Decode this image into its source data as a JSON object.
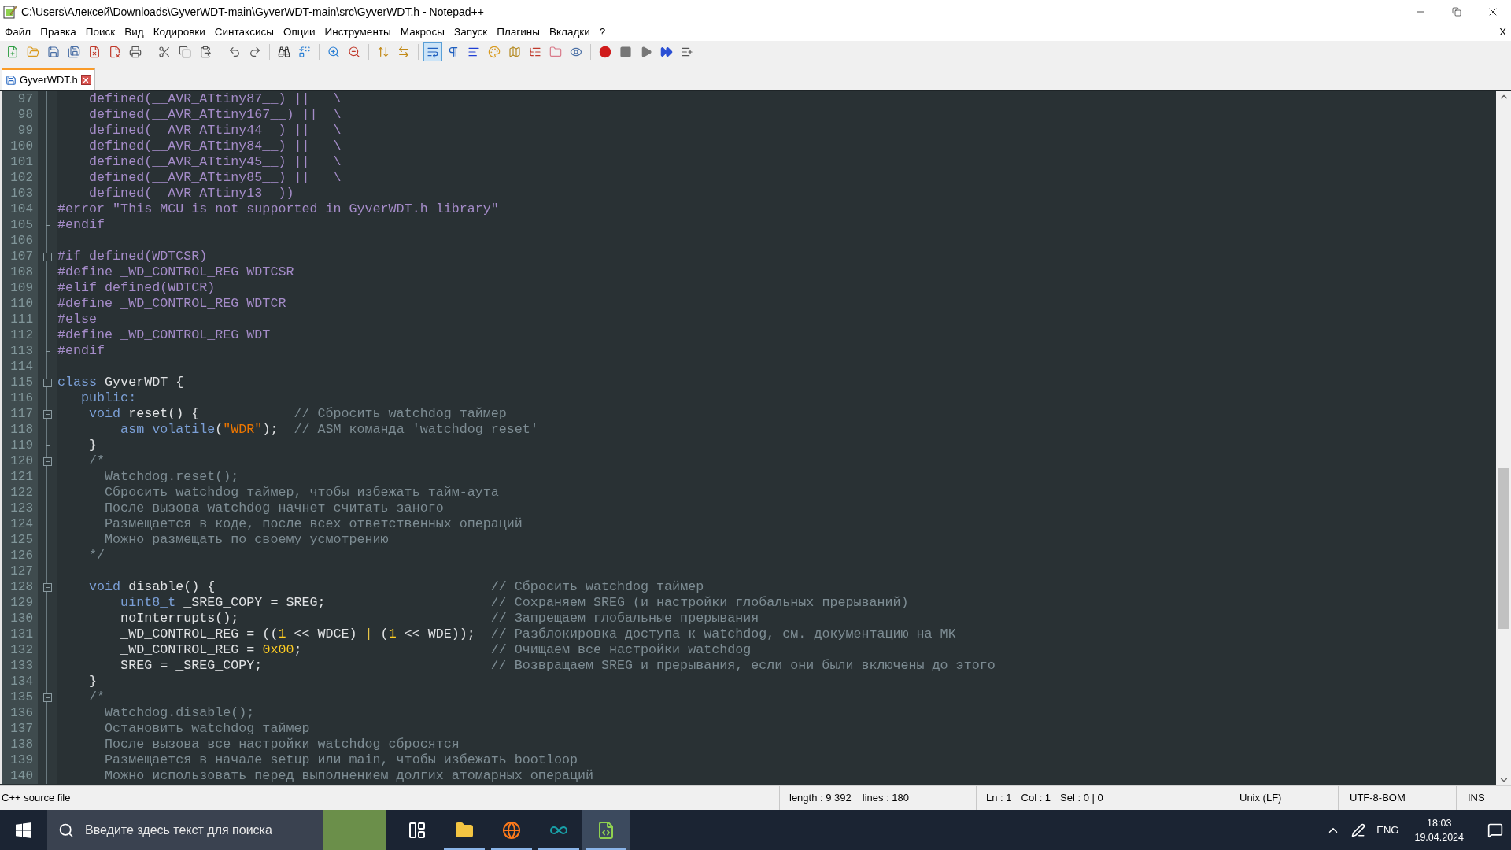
{
  "window": {
    "title": "C:\\Users\\Алексей\\Downloads\\GyverWDT-main\\GyverWDT-main\\src\\GyverWDT.h - Notepad++"
  },
  "menu": {
    "items": [
      "Файл",
      "Правка",
      "Поиск",
      "Вид",
      "Кодировки",
      "Синтаксисы",
      "Опции",
      "Инструменты",
      "Макросы",
      "Запуск",
      "Плагины",
      "Вкладки",
      "?"
    ],
    "close_char": "X"
  },
  "toolbar": [
    {
      "kind": "new",
      "pressed": false
    },
    {
      "kind": "open",
      "pressed": false
    },
    {
      "kind": "save",
      "pressed": false
    },
    {
      "kind": "save-all",
      "pressed": false
    },
    {
      "kind": "close",
      "pressed": false
    },
    {
      "kind": "close-all",
      "pressed": false
    },
    {
      "kind": "print",
      "pressed": false
    },
    {
      "kind": "separator"
    },
    {
      "kind": "cut",
      "pressed": false
    },
    {
      "kind": "copy",
      "pressed": false
    },
    {
      "kind": "paste",
      "pressed": false
    },
    {
      "kind": "separator"
    },
    {
      "kind": "undo",
      "pressed": false
    },
    {
      "kind": "redo",
      "pressed": false
    },
    {
      "kind": "separator"
    },
    {
      "kind": "find",
      "pressed": false
    },
    {
      "kind": "replace",
      "pressed": false
    },
    {
      "kind": "separator"
    },
    {
      "kind": "zoom-in",
      "pressed": false
    },
    {
      "kind": "zoom-out",
      "pressed": false
    },
    {
      "kind": "separator"
    },
    {
      "kind": "sync-vertical",
      "pressed": false
    },
    {
      "kind": "sync-horizontal",
      "pressed": false
    },
    {
      "kind": "separator"
    },
    {
      "kind": "wrap",
      "pressed": true
    },
    {
      "kind": "all-chars",
      "pressed": false
    },
    {
      "kind": "indent-guide",
      "pressed": false
    },
    {
      "kind": "language",
      "pressed": false
    },
    {
      "kind": "doc-map",
      "pressed": false
    },
    {
      "kind": "function-list",
      "pressed": false
    },
    {
      "kind": "folder",
      "pressed": false
    },
    {
      "kind": "monitor",
      "pressed": false
    },
    {
      "kind": "separator"
    },
    {
      "kind": "record",
      "pressed": false
    },
    {
      "kind": "stop",
      "pressed": false
    },
    {
      "kind": "play",
      "pressed": false
    },
    {
      "kind": "play-multiple",
      "pressed": false
    },
    {
      "kind": "save-macro",
      "pressed": false
    }
  ],
  "tabs": [
    {
      "label": "GyverWDT.h",
      "selected": true
    }
  ],
  "editor": {
    "lines": [
      {
        "number": "97",
        "fold_open": false,
        "fold_end": false,
        "tokens": [
          {
            "kind": "pre",
            "text": "    defined(__AVR_ATtiny87__) ||   \\"
          }
        ]
      },
      {
        "number": "98",
        "fold_open": false,
        "fold_end": false,
        "tokens": [
          {
            "kind": "pre",
            "text": "    defined(__AVR_ATtiny167__) ||  \\"
          }
        ]
      },
      {
        "number": "99",
        "fold_open": false,
        "fold_end": false,
        "tokens": [
          {
            "kind": "pre",
            "text": "    defined(__AVR_ATtiny44__) ||   \\"
          }
        ]
      },
      {
        "number": "100",
        "fold_open": false,
        "fold_end": false,
        "tokens": [
          {
            "kind": "pre",
            "text": "    defined(__AVR_ATtiny84__) ||   \\"
          }
        ]
      },
      {
        "number": "101",
        "fold_open": false,
        "fold_end": false,
        "tokens": [
          {
            "kind": "pre",
            "text": "    defined(__AVR_ATtiny45__) ||   \\"
          }
        ]
      },
      {
        "number": "102",
        "fold_open": false,
        "fold_end": false,
        "tokens": [
          {
            "kind": "pre",
            "text": "    defined(__AVR_ATtiny85__) ||   \\"
          }
        ]
      },
      {
        "number": "103",
        "fold_open": false,
        "fold_end": false,
        "tokens": [
          {
            "kind": "pre",
            "text": "    defined(__AVR_ATtiny13__))"
          }
        ]
      },
      {
        "number": "104",
        "fold_open": false,
        "fold_end": false,
        "tokens": [
          {
            "kind": "pre",
            "text": "#error \"This MCU is not supported in GyverWDT.h library\""
          }
        ]
      },
      {
        "number": "105",
        "fold_open": false,
        "fold_end": true,
        "tokens": [
          {
            "kind": "pre",
            "text": "#endif"
          }
        ]
      },
      {
        "number": "106",
        "fold_open": false,
        "fold_end": false
      },
      {
        "number": "107",
        "fold_open": true,
        "fold_end": false,
        "tokens": [
          {
            "kind": "pre",
            "text": "#if defined(WDTCSR)"
          }
        ]
      },
      {
        "number": "108",
        "fold_open": false,
        "fold_end": false,
        "tokens": [
          {
            "kind": "pre",
            "text": "#define _WD_CONTROL_REG WDTCSR"
          }
        ]
      },
      {
        "number": "109",
        "fold_open": false,
        "fold_end": false,
        "tokens": [
          {
            "kind": "pre",
            "text": "#elif defined(WDTCR)"
          }
        ]
      },
      {
        "number": "110",
        "fold_open": false,
        "fold_end": false,
        "tokens": [
          {
            "kind": "pre",
            "text": "#define _WD_CONTROL_REG WDTCR"
          }
        ]
      },
      {
        "number": "111",
        "fold_open": false,
        "fold_end": false,
        "tokens": [
          {
            "kind": "pre",
            "text": "#else"
          }
        ]
      },
      {
        "number": "112",
        "fold_open": false,
        "fold_end": false,
        "tokens": [
          {
            "kind": "pre",
            "text": "#define _WD_CONTROL_REG WDT"
          }
        ]
      },
      {
        "number": "113",
        "fold_open": false,
        "fold_end": true,
        "tokens": [
          {
            "kind": "pre",
            "text": "#endif"
          }
        ]
      },
      {
        "number": "114",
        "fold_open": false,
        "fold_end": false
      },
      {
        "number": "115",
        "fold_open": true,
        "fold_end": false,
        "tokens": [
          {
            "kind": "keyword",
            "text": "class"
          },
          {
            "kind": "plain",
            "text": " GyverWDT {"
          }
        ]
      },
      {
        "number": "116",
        "fold_open": false,
        "fold_end": false,
        "tokens": [
          {
            "kind": "keyword",
            "text": "   public:"
          }
        ]
      },
      {
        "number": "117",
        "fold_open": true,
        "fold_end": false,
        "tokens": [
          {
            "kind": "keyword",
            "text": "    void"
          },
          {
            "kind": "plain",
            "text": " reset() {            "
          },
          {
            "kind": "comment",
            "text": "// Сбросить watchdog таймер"
          }
        ]
      },
      {
        "number": "118",
        "fold_open": false,
        "fold_end": false,
        "tokens": [
          {
            "kind": "keyword",
            "text": "        asm volatile"
          },
          {
            "kind": "plain",
            "text": "("
          },
          {
            "kind": "string",
            "text": "\"WDR\""
          },
          {
            "kind": "plain",
            "text": ");  "
          },
          {
            "kind": "comment",
            "text": "// ASM команда 'watchdog reset'"
          }
        ]
      },
      {
        "number": "119",
        "fold_open": false,
        "fold_end": true,
        "tokens": [
          {
            "kind": "plain",
            "text": "    }"
          }
        ]
      },
      {
        "number": "120",
        "fold_open": true,
        "fold_end": false,
        "tokens": [
          {
            "kind": "comment",
            "text": "    /*"
          }
        ]
      },
      {
        "number": "121",
        "fold_open": false,
        "fold_end": false,
        "tokens": [
          {
            "kind": "comment",
            "text": "      Watchdog.reset();"
          }
        ]
      },
      {
        "number": "122",
        "fold_open": false,
        "fold_end": false,
        "tokens": [
          {
            "kind": "comment",
            "text": "      Сбросить watchdog таймер, чтобы избежать тайм-аута"
          }
        ]
      },
      {
        "number": "123",
        "fold_open": false,
        "fold_end": false,
        "tokens": [
          {
            "kind": "comment",
            "text": "      После вызова watchdog начнет считать заного"
          }
        ]
      },
      {
        "number": "124",
        "fold_open": false,
        "fold_end": false,
        "tokens": [
          {
            "kind": "comment",
            "text": "      Размещается в коде, после всех ответственных операций"
          }
        ]
      },
      {
        "number": "125",
        "fold_open": false,
        "fold_end": false,
        "tokens": [
          {
            "kind": "comment",
            "text": "      Можно размещать по своему усмотрению"
          }
        ]
      },
      {
        "number": "126",
        "fold_open": false,
        "fold_end": true,
        "tokens": [
          {
            "kind": "comment",
            "text": "    */"
          }
        ]
      },
      {
        "number": "127",
        "fold_open": false,
        "fold_end": false
      },
      {
        "number": "128",
        "fold_open": true,
        "fold_end": false,
        "tokens": [
          {
            "kind": "keyword",
            "text": "    void"
          },
          {
            "kind": "plain",
            "text": " disable() {                                   "
          },
          {
            "kind": "comment",
            "text": "// Сбросить watchdog таймер"
          }
        ]
      },
      {
        "number": "129",
        "fold_open": false,
        "fold_end": false,
        "tokens": [
          {
            "kind": "keyword",
            "text": "        uint8_t"
          },
          {
            "kind": "plain",
            "text": " _SREG_COPY = SREG;                     "
          },
          {
            "kind": "comment",
            "text": "// Сохраняем SREG (и настройки глобальных прерываний)"
          }
        ]
      },
      {
        "number": "130",
        "fold_open": false,
        "fold_end": false,
        "tokens": [
          {
            "kind": "plain",
            "text": "        noInterrupts();                                "
          },
          {
            "kind": "comment",
            "text": "// Запрещаем глобальные прерывания"
          }
        ]
      },
      {
        "number": "131",
        "fold_open": false,
        "fold_end": false,
        "tokens": [
          {
            "kind": "plain",
            "text": "        _WD_CONTROL_REG = (("
          },
          {
            "kind": "number",
            "text": "1"
          },
          {
            "kind": "plain",
            "text": " << WDCE) "
          },
          {
            "kind": "operator",
            "text": "|"
          },
          {
            "kind": "plain",
            "text": " ("
          },
          {
            "kind": "number",
            "text": "1"
          },
          {
            "kind": "plain",
            "text": " << WDE));  "
          },
          {
            "kind": "comment",
            "text": "// Разблокировка доступа к watchdog, см. документацию на МК"
          }
        ]
      },
      {
        "number": "132",
        "fold_open": false,
        "fold_end": false,
        "tokens": [
          {
            "kind": "plain",
            "text": "        _WD_CONTROL_REG = "
          },
          {
            "kind": "number",
            "text": "0x00"
          },
          {
            "kind": "plain",
            "text": ";                        "
          },
          {
            "kind": "comment",
            "text": "// Очищаем все настройки watchdog"
          }
        ]
      },
      {
        "number": "133",
        "fold_open": false,
        "fold_end": false,
        "tokens": [
          {
            "kind": "plain",
            "text": "        SREG = _SREG_COPY;                             "
          },
          {
            "kind": "comment",
            "text": "// Возвращаем SREG и прерывания, если они были включены до этого"
          }
        ]
      },
      {
        "number": "134",
        "fold_open": false,
        "fold_end": true,
        "tokens": [
          {
            "kind": "plain",
            "text": "    }"
          }
        ]
      },
      {
        "number": "135",
        "fold_open": true,
        "fold_end": false,
        "tokens": [
          {
            "kind": "comment",
            "text": "    /*"
          }
        ]
      },
      {
        "number": "136",
        "fold_open": false,
        "fold_end": false,
        "tokens": [
          {
            "kind": "comment",
            "text": "      Watchdog.disable();"
          }
        ]
      },
      {
        "number": "137",
        "fold_open": false,
        "fold_end": false,
        "tokens": [
          {
            "kind": "comment",
            "text": "      Остановить watchdog таймер"
          }
        ]
      },
      {
        "number": "138",
        "fold_open": false,
        "fold_end": false,
        "tokens": [
          {
            "kind": "comment",
            "text": "      После вызова все настройки watchdog сбросятся"
          }
        ]
      },
      {
        "number": "139",
        "fold_open": false,
        "fold_end": false,
        "tokens": [
          {
            "kind": "comment",
            "text": "      Размещается в начале setup или main, чтобы избежать bootloop"
          }
        ]
      },
      {
        "number": "140",
        "fold_open": false,
        "fold_end": false,
        "tokens": [
          {
            "kind": "comment",
            "text": "      Можно использовать перед выполнением долгих атомарных операций"
          }
        ]
      }
    ]
  },
  "status_bar": {
    "file_type": "C++ source file",
    "length": "length : 9 392",
    "lines": "lines : 180",
    "ln": "Ln : 1",
    "col": "Col : 1",
    "sel": "Sel : 0 | 0",
    "eol": "Unix (LF)",
    "encoding": "UTF-8-BOM",
    "mode": "INS"
  },
  "taskbar": {
    "search_placeholder": "Введите здесь текст для поиска",
    "apps": [
      {
        "kind": "task-view",
        "running": false,
        "selected": false
      },
      {
        "kind": "explorer",
        "running": true,
        "selected": false
      },
      {
        "kind": "browser",
        "running": true,
        "selected": false
      },
      {
        "kind": "arduino",
        "running": true,
        "selected": false
      },
      {
        "kind": "notepad",
        "running": true,
        "selected": true
      }
    ],
    "language": "ENG",
    "time": "18:03",
    "date": "19.04.2024"
  }
}
